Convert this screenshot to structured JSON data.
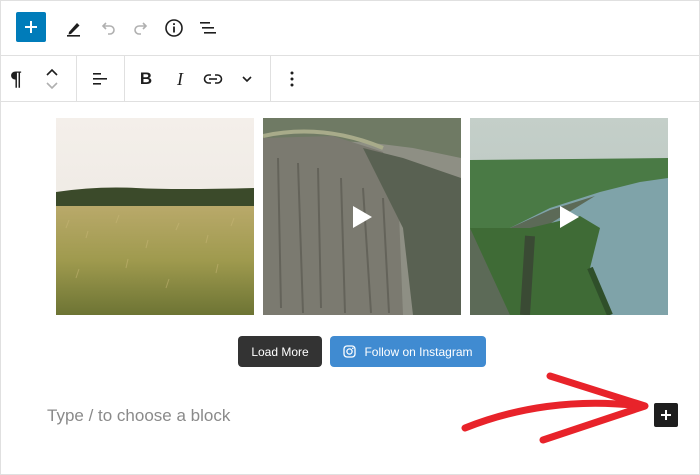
{
  "top_toolbar": {
    "icons": [
      "plus-icon",
      "pencil-icon",
      "undo-icon",
      "redo-icon",
      "info-icon",
      "list-view-icon"
    ],
    "accent": "#007cba"
  },
  "block_toolbar": {
    "paragraph_glyph": "¶",
    "bold_label": "B",
    "italic_label": "I",
    "icons": [
      "paragraph-icon",
      "move-up-icon",
      "move-down-icon",
      "align-left-icon",
      "bold-icon",
      "italic-icon",
      "link-icon",
      "chevron-down-icon",
      "more-options-icon"
    ]
  },
  "feed": {
    "tiles": [
      {
        "subject": "wheat field",
        "video": false
      },
      {
        "subject": "rocky cliff",
        "video": true
      },
      {
        "subject": "sea cliffs",
        "video": true
      }
    ],
    "load_more_label": "Load More",
    "follow_label": "Follow on Instagram",
    "load_more_color": "#333333",
    "follow_color": "#408bd1"
  },
  "appender": {
    "placeholder": "Type / to choose a block"
  },
  "annotation": {
    "color": "#e8232a"
  }
}
